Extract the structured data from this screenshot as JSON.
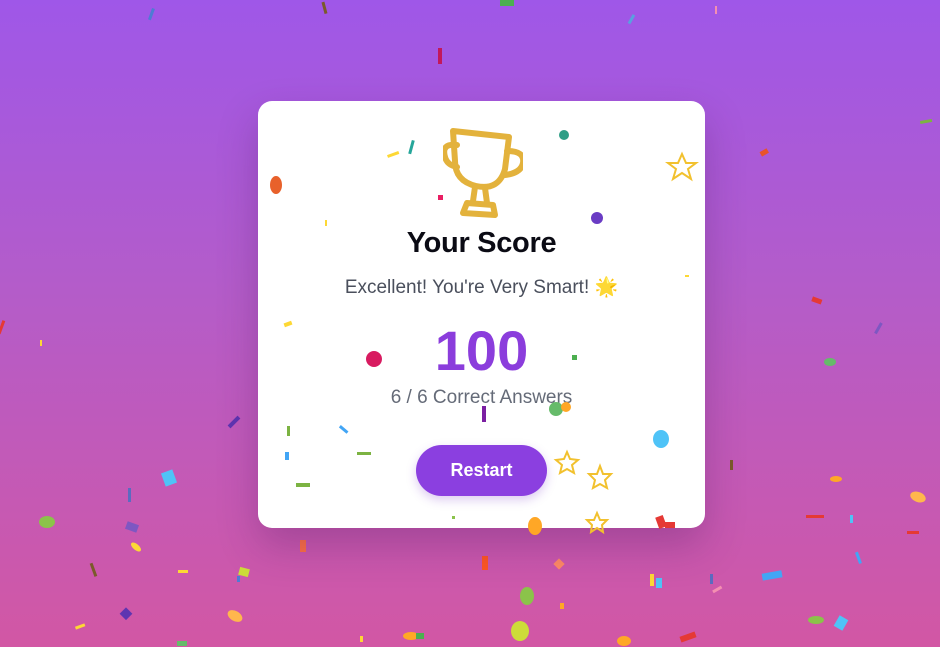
{
  "result": {
    "title": "Your Score",
    "message": "Excellent! You're Very Smart!",
    "message_emoji": "🌟",
    "score": "100",
    "answers": "6 / 6 Correct Answers",
    "restart_label": "Restart"
  },
  "icons": {
    "trophy": "trophy-icon",
    "stars": "star-outline-icon"
  },
  "colors": {
    "background_top": "#9f57e8",
    "background_bottom": "#d257a4",
    "accent": "#8b3fe0",
    "trophy": "#e3b23c"
  }
}
